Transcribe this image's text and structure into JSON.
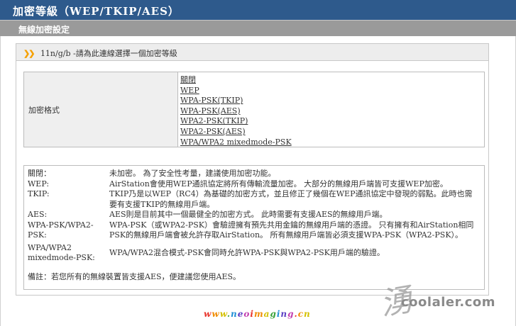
{
  "header": {
    "title": "加密等級（WEP/TKIP/AES）",
    "subtitle": "無線加密設定"
  },
  "panel": {
    "section_label": "11n/g/b -請為此連線選擇一個加密等級"
  },
  "encryption": {
    "label": "加密格式",
    "options": [
      "關閉",
      "WEP",
      "WPA-PSK(TKIP)",
      "WPA-PSK(AES)",
      "WPA2-PSK(TKIP)",
      "WPA2-PSK(AES)",
      "WPA/WPA2 mixedmode-PSK"
    ]
  },
  "descriptions": [
    {
      "key": "關閉：",
      "text": "未加密。 為了安全性考量，建議使用加密功能。"
    },
    {
      "key": "WEP:",
      "text": "AirStation會使用WEP通訊協定將所有傳輸流量加密。 大部分的無線用戶端皆可支援WEP加密。"
    },
    {
      "key": "TKIP:",
      "text": "TKIP乃是以WEP（RC4）為基礎的加密方式，並且修正了幾個在WEP通訊協定中發現的弱點。此時也需要有支援TKIP的無線用戶端。"
    },
    {
      "key": "AES:",
      "text": "AES則是目前其中一個最健全的加密方式。 此時需要有支援AES的無線用戶端。"
    },
    {
      "key": "WPA-PSK/WPA2-PSK:",
      "text": "WPA-PSK（或WPA2-PSK）會驗證擁有預先共用金鑰的無線用戶端的憑證。 只有擁有和AirStation相同PSK的無線用戶端會被允許存取AirStation。 所有無線用戶端皆必須支援WPA-PSK（WPA2-PSK）。"
    },
    {
      "key": "WPA/WPA2 mixedmode-PSK:",
      "text": "WPA/WPA2混合模式-PSK會同時允許WPA-PSK與WPA2-PSK用戶端的驗證。"
    }
  ],
  "note": "備註：若您所有的無線裝置皆支援AES，便建議您使用AES。",
  "watermark": {
    "site": "www.neoimaging.cn",
    "brand": "coolaler.com",
    "signature": "湧"
  },
  "colors": {
    "title_bar": "#2e5a8c",
    "sub_bar": "#9a9a9a",
    "bullet": "#f5a000"
  }
}
